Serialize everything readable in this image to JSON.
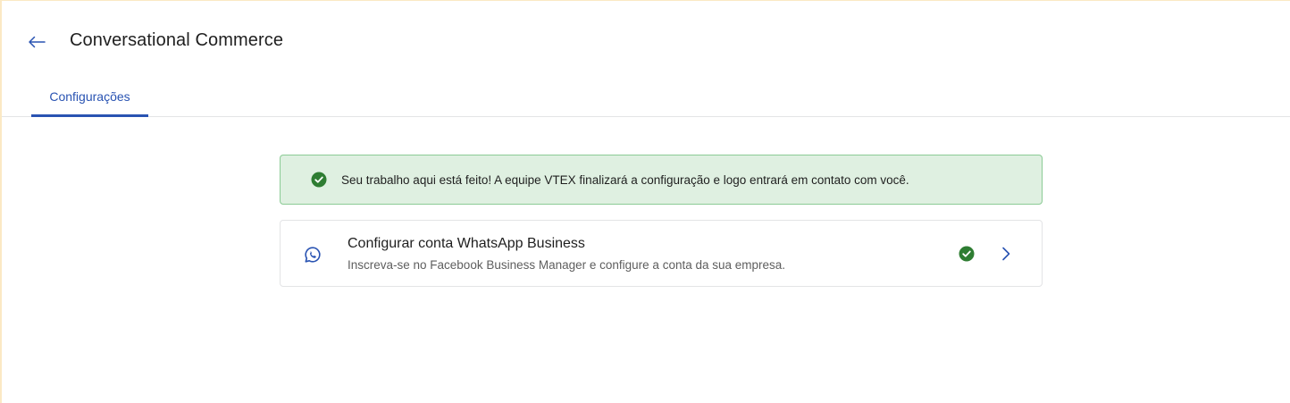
{
  "header": {
    "title": "Conversational Commerce",
    "back_icon": "arrow-left-icon"
  },
  "tabs": [
    {
      "label": "Configurações",
      "active": true
    }
  ],
  "alert": {
    "type": "success",
    "icon": "check-circle-icon",
    "message": "Seu trabalho aqui está feito! A equipe VTEX finalizará a configuração e logo entrará em contato com você."
  },
  "card": {
    "icon": "whatsapp-icon",
    "title": "Configurar conta WhatsApp Business",
    "description": "Inscreva-se no Facebook Business Manager e configure a conta da sua empresa.",
    "status_icon": "check-circle-icon",
    "action_icon": "chevron-right-icon"
  },
  "colors": {
    "accent": "#2953b2",
    "success": "#2e7d32",
    "alert_bg": "#dff0e1",
    "alert_border": "#8bcb95"
  }
}
